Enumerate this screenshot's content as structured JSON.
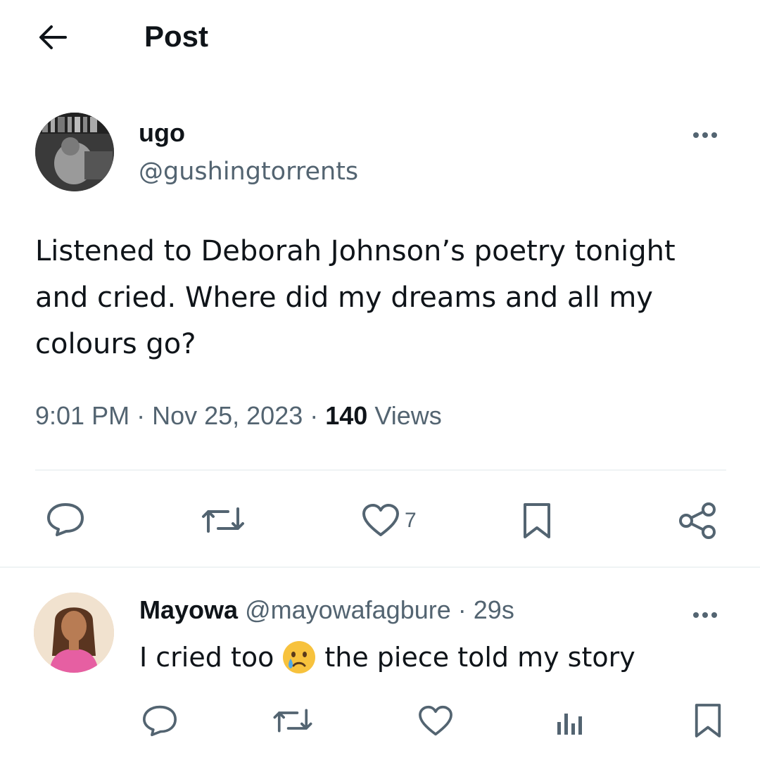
{
  "header": {
    "title": "Post",
    "back_icon": "arrow-left-icon"
  },
  "post": {
    "author_name": "ugo",
    "author_handle": "@gushingtorrents",
    "text": "Listened to Deborah Johnson’s poetry tonight and cried. Where did my dreams and all my colours go?",
    "time": "9:01 PM",
    "date": "Nov 25, 2023",
    "views_count": "140",
    "views_label": "Views",
    "like_count": "7"
  },
  "reply": {
    "author_name": "Mayowa",
    "author_handle": "@mayowafagbure",
    "time": "29s",
    "text_before": "I cried too",
    "emoji": "crying-face",
    "text_after": "the piece told my story"
  },
  "colors": {
    "text": "#0f1419",
    "secondary": "#536471",
    "divider": "#eff3f4"
  }
}
